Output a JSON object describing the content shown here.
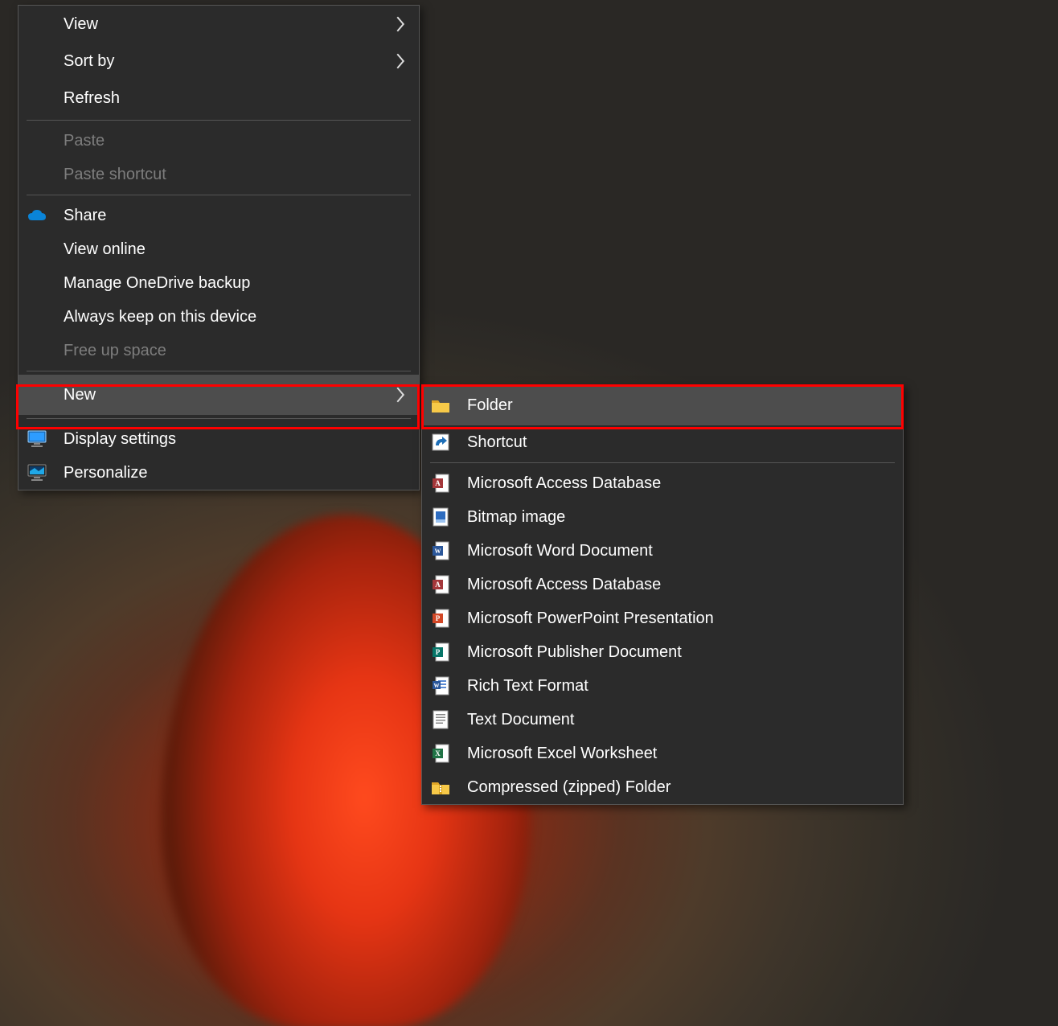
{
  "context_menu": {
    "items": [
      {
        "label": "View",
        "submenu": true
      },
      {
        "label": "Sort by",
        "submenu": true
      },
      {
        "label": "Refresh"
      },
      {
        "sep": true
      },
      {
        "label": "Paste",
        "disabled": true
      },
      {
        "label": "Paste shortcut",
        "disabled": true
      },
      {
        "sep": true
      },
      {
        "label": "Share",
        "icon": "onedrive"
      },
      {
        "label": "View online"
      },
      {
        "label": "Manage OneDrive backup"
      },
      {
        "label": "Always keep on this device"
      },
      {
        "label": "Free up space",
        "disabled": true
      },
      {
        "sep": true
      },
      {
        "label": "New",
        "submenu": true,
        "hover": true,
        "highlight": true
      },
      {
        "sep": true
      },
      {
        "label": "Display settings",
        "icon": "display"
      },
      {
        "label": "Personalize",
        "icon": "personalize"
      }
    ]
  },
  "new_submenu": {
    "items": [
      {
        "label": "Folder",
        "icon": "folder",
        "hover": true,
        "highlight": true
      },
      {
        "label": "Shortcut",
        "icon": "shortcut"
      },
      {
        "sep": true
      },
      {
        "label": "Microsoft Access Database",
        "icon": "access"
      },
      {
        "label": "Bitmap image",
        "icon": "bitmap"
      },
      {
        "label": "Microsoft Word Document",
        "icon": "word"
      },
      {
        "label": "Microsoft Access Database",
        "icon": "access2"
      },
      {
        "label": "Microsoft PowerPoint Presentation",
        "icon": "powerpoint"
      },
      {
        "label": "Microsoft Publisher Document",
        "icon": "publisher"
      },
      {
        "label": "Rich Text Format",
        "icon": "rtf"
      },
      {
        "label": "Text Document",
        "icon": "text"
      },
      {
        "label": "Microsoft Excel Worksheet",
        "icon": "excel"
      },
      {
        "label": "Compressed (zipped) Folder",
        "icon": "zip"
      }
    ]
  }
}
